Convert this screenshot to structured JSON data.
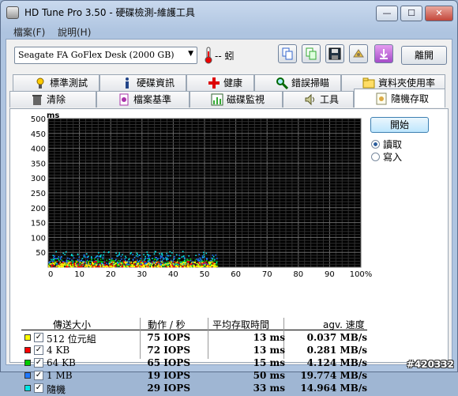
{
  "window": {
    "title": "HD Tune Pro 3.50 - 硬碟檢測-維護工具",
    "minimize_glyph": "—",
    "maximize_glyph": "☐",
    "close_glyph": "✕"
  },
  "menu": [
    "檔案(F)",
    "說明(H)"
  ],
  "toolbar": {
    "drive": "Seagate FA GoFlex Desk (2000 GB)",
    "temperature": "-- 蚓",
    "exit_label": "離開",
    "icons": [
      "copy-icon",
      "copy-text-icon",
      "save-icon",
      "screenshot-icon",
      "download-icon"
    ]
  },
  "tabs_row1": [
    {
      "label": "標準測試",
      "icon": "benchmark-icon"
    },
    {
      "label": "硬碟資訊",
      "icon": "info-icon"
    },
    {
      "label": "健康",
      "icon": "health-icon"
    },
    {
      "label": "錯誤掃瞄",
      "icon": "magnifier-icon"
    },
    {
      "label": "資料夾使用率",
      "icon": "folder-icon"
    }
  ],
  "tabs_row2": [
    {
      "label": "清除",
      "icon": "trash-icon"
    },
    {
      "label": "檔案基準",
      "icon": "file-benchmark-icon"
    },
    {
      "label": "磁碟監視",
      "icon": "monitor-icon"
    },
    {
      "label": "工具",
      "icon": "speaker-icon"
    },
    {
      "label": "隨機存取",
      "icon": "random-access-icon"
    }
  ],
  "controls": {
    "start_label": "開始",
    "read_label": "讀取",
    "write_label": "寫入",
    "mode_selected": "讀取"
  },
  "chart_data": {
    "type": "scatter",
    "y_unit": "ms",
    "x_unit": "%",
    "ylim": [
      0,
      500
    ],
    "xlim": [
      0,
      100
    ],
    "y_ticks": [
      500,
      450,
      400,
      350,
      300,
      250,
      200,
      150,
      100,
      50
    ],
    "x_ticks": [
      "0",
      "10",
      "20",
      "30",
      "40",
      "50",
      "60",
      "70",
      "80",
      "90",
      "100%"
    ],
    "background": "#000000",
    "grid": true,
    "series": [
      {
        "color": "#ffff00",
        "x_range": [
          0,
          54
        ],
        "y_range": [
          3,
          20
        ]
      },
      {
        "color": "#ff0000",
        "x_range": [
          0,
          54
        ],
        "y_range": [
          3,
          22
        ]
      },
      {
        "color": "#00cc00",
        "x_range": [
          0,
          54
        ],
        "y_range": [
          5,
          30
        ]
      },
      {
        "color": "#1e78ff",
        "x_range": [
          0,
          54
        ],
        "y_range": [
          10,
          45
        ]
      },
      {
        "color": "#00e5e5",
        "x_range": [
          0,
          54
        ],
        "y_range": [
          8,
          55
        ]
      }
    ]
  },
  "results": {
    "headers": [
      "傳送大小",
      "動作 / 秒",
      "平均存取時間",
      "agv. 速度"
    ],
    "rows": [
      {
        "color": "#ffff00",
        "label": "512 位元組",
        "ops": "75 IOPS",
        "time": "13 ms",
        "speed": "0.037 MB/s"
      },
      {
        "color": "#ff0000",
        "label": "4 KB",
        "ops": "72 IOPS",
        "time": "13 ms",
        "speed": "0.281 MB/s"
      },
      {
        "color": "#00cc00",
        "label": "64 KB",
        "ops": "65 IOPS",
        "time": "15 ms",
        "speed": "4.124 MB/s"
      },
      {
        "color": "#1e78ff",
        "label": "1 MB",
        "ops": "19 IOPS",
        "time": "50 ms",
        "speed": "19.774 MB/s"
      },
      {
        "color": "#00e5e5",
        "label": "隨機",
        "ops": "29 IOPS",
        "time": "33 ms",
        "speed": "14.964 MB/s"
      }
    ]
  },
  "watermark": "#420332"
}
